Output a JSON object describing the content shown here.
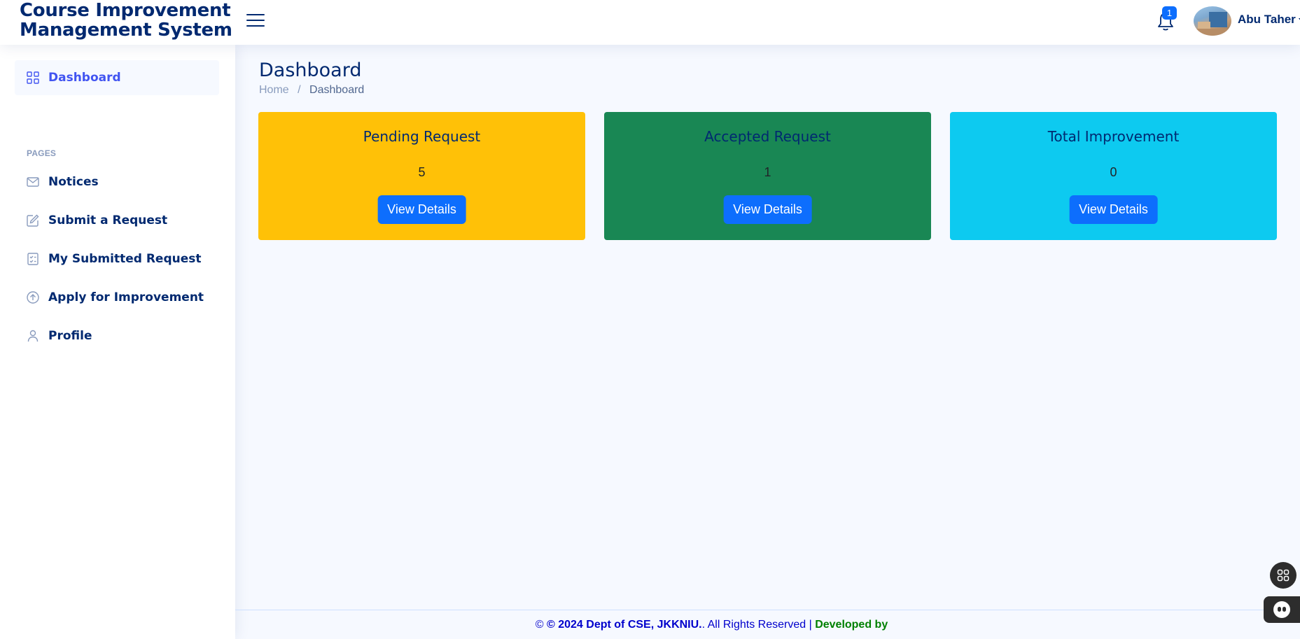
{
  "header": {
    "logo_line1": "Course Improvement",
    "logo_line2": "Management System",
    "notification_count": "1",
    "user_name": "Abu Taher"
  },
  "sidebar": {
    "dashboard_label": "Dashboard",
    "pages_heading": "PAGES",
    "items": [
      {
        "label": "Notices",
        "icon": "envelope-icon"
      },
      {
        "label": "Submit a Request",
        "icon": "edit-icon"
      },
      {
        "label": "My Submitted Request",
        "icon": "checklist-icon"
      },
      {
        "label": "Apply for Improvement",
        "icon": "arrow-up-circle-icon"
      },
      {
        "label": "Profile",
        "icon": "person-icon"
      }
    ]
  },
  "main": {
    "title": "Dashboard",
    "breadcrumb": {
      "home": "Home",
      "separator": "/",
      "current": "Dashboard"
    },
    "cards": [
      {
        "title": "Pending Request",
        "value": "5",
        "button": "View Details",
        "color": "#ffc107"
      },
      {
        "title": "Accepted Request",
        "value": "1",
        "button": "View Details",
        "color": "#198754"
      },
      {
        "title": "Total Improvement",
        "value": "0",
        "button": "View Details",
        "color": "#0dcaf0"
      }
    ]
  },
  "footer": {
    "copy_prefix": "© ",
    "copy_bold": "© 2024 Dept of CSE, JKKNIU.",
    "copy_rest": ". All Rights Reserved | ",
    "developed": "Developed by"
  },
  "colors": {
    "brand": "#012970",
    "accent": "#4154f1",
    "button": "#0d6efd"
  }
}
